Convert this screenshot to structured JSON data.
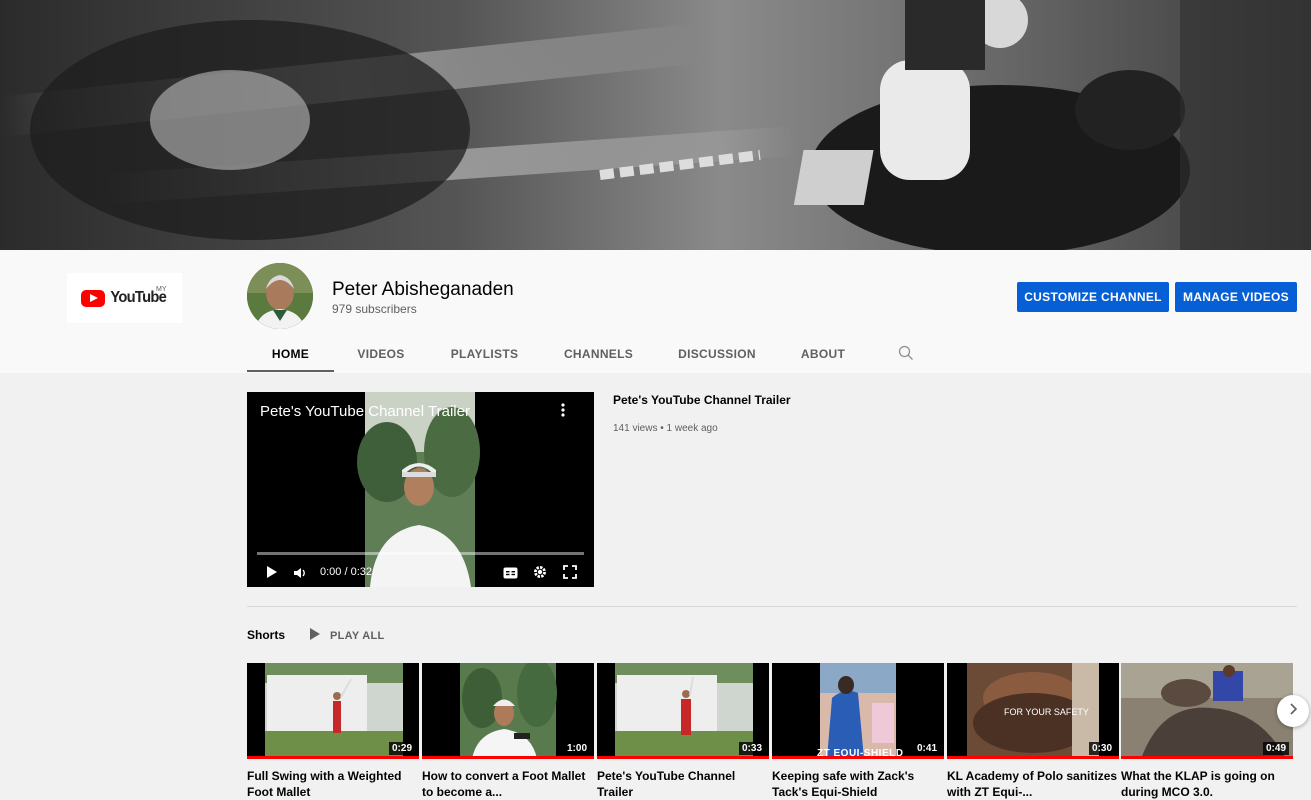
{
  "channel": {
    "name": "Peter Abisheganaden",
    "subscribers": "979 subscribers",
    "logo_word": "YouTube",
    "logo_region": "MY"
  },
  "actions": {
    "customize": "CUSTOMIZE CHANNEL",
    "manage": "MANAGE VIDEOS"
  },
  "tabs": [
    "HOME",
    "VIDEOS",
    "PLAYLISTS",
    "CHANNELS",
    "DISCUSSION",
    "ABOUT"
  ],
  "trailer": {
    "overlay_title": "Pete's YouTube Channel Trailer",
    "title": "Pete's YouTube Channel Trailer",
    "meta": "141 views • 1 week ago",
    "time": "0:00 / 0:32"
  },
  "shorts": {
    "heading": "Shorts",
    "play_all": "PLAY ALL",
    "items": [
      {
        "title": "Full Swing with a Weighted Foot Mallet",
        "duration": "0:29"
      },
      {
        "title": "How to convert a Foot Mallet to become a...",
        "duration": "1:00"
      },
      {
        "title": "Pete's YouTube Channel Trailer",
        "duration": "0:33"
      },
      {
        "title": "Keeping safe with Zack's Tack's Equi-Shield",
        "duration": "0:41",
        "overlay": "ZT EQUI-SHIELD"
      },
      {
        "title": "KL Academy of Polo sanitizes with ZT Equi-...",
        "duration": "0:30",
        "overlay": "FOR YOUR SAFETY"
      },
      {
        "title": "What the KLAP is going on during MCO 3.0.",
        "duration": "0:49"
      }
    ]
  },
  "colors": {
    "accent": "#065fd4",
    "progress_red": "#ff0000",
    "logo_red": "#ff0000"
  }
}
